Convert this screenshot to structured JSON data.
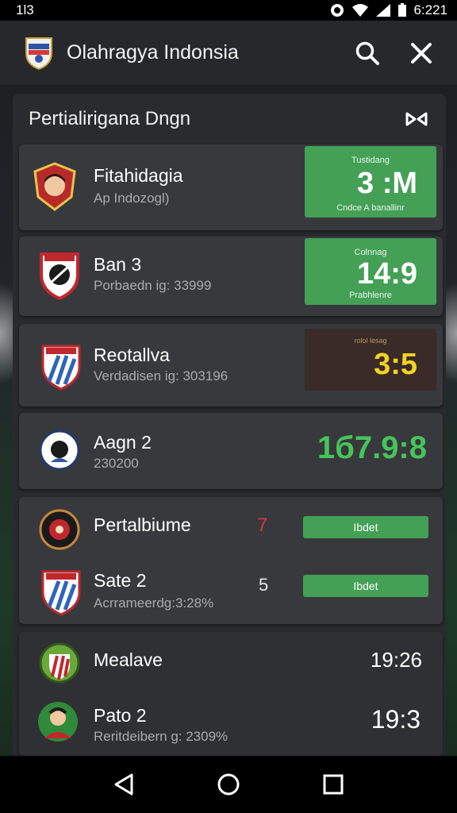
{
  "status": {
    "left": "1l3",
    "time": "6:221"
  },
  "app": {
    "title": "Olahragya Indonsia"
  },
  "panel": {
    "title": "Pertialirigana Dngn"
  },
  "matches": [
    {
      "team": "Fitahidagia",
      "sub": "Ap Indozogl)",
      "score_top": "Tustidang",
      "score": "3 :M",
      "score_bottom": "Cndce A banallinr"
    },
    {
      "team": "Ban 3",
      "sub": "Porbaedn ig: 33999",
      "score_top": "Colnnag",
      "score": "14:9",
      "score_bottom": "Prabhlenre"
    },
    {
      "team": "Reotallva",
      "sub": "Verdadisen ig: 303196",
      "score_top": "rolol lesag",
      "score": "3:5"
    },
    {
      "team": "Aagn 2",
      "sub": "230200",
      "score": "1б7.9:8"
    }
  ],
  "group": {
    "rows": [
      {
        "team": "Pertalbiume",
        "score": "7",
        "button": "Ibdet"
      },
      {
        "team": "Sate 2",
        "sub": "Acrrameerdg:3:28%",
        "score": "5",
        "button": "Ibdet"
      }
    ]
  },
  "group2": {
    "rows": [
      {
        "team": "Mealave",
        "time": "19:26"
      },
      {
        "team": "Pato 2",
        "sub": "Reritdeibern g: 2309%",
        "time": "19:3"
      }
    ]
  },
  "colors": {
    "accent": "#43a055",
    "score_yellow": "#f2d321",
    "score_green": "#46c45a",
    "score_red": "#d63a3a"
  },
  "icons": [
    "search-icon",
    "close-icon",
    "expand-icon",
    "back-icon",
    "home-icon",
    "recents-icon"
  ]
}
